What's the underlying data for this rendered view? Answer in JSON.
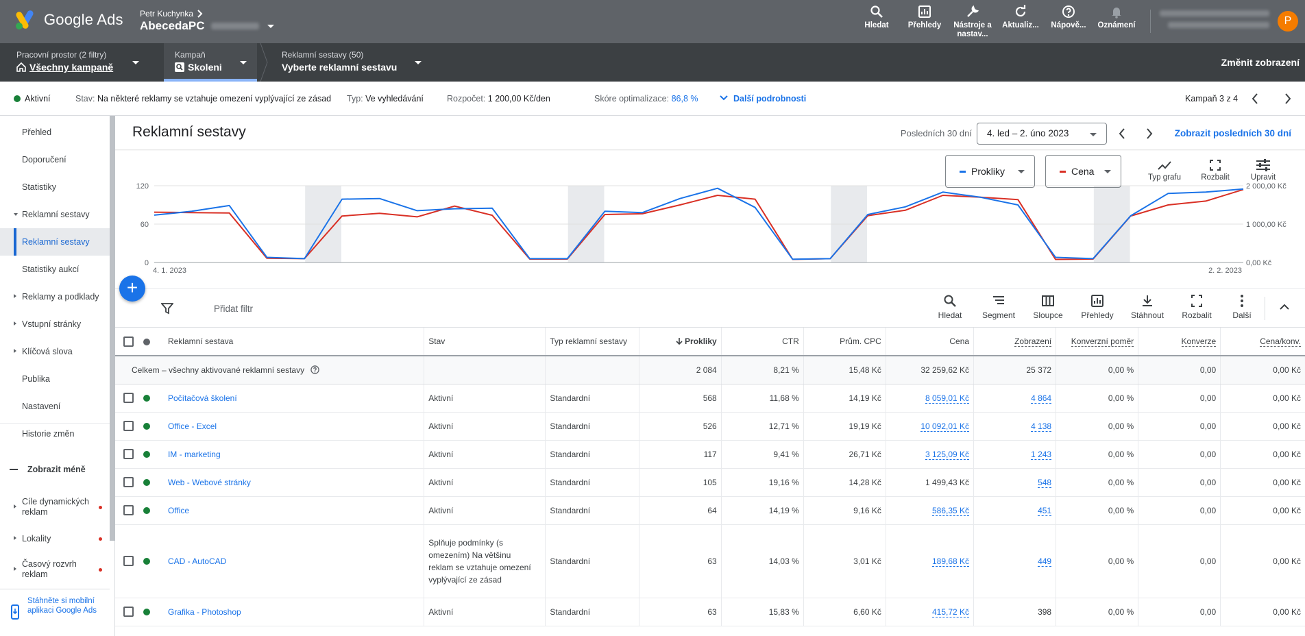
{
  "app": {
    "title": "Google Ads",
    "accent": "#1a73e8"
  },
  "account": {
    "name": "Petr Kuchynka",
    "sub": "AbecedaPC",
    "avatar_letter": "P"
  },
  "toolbar": {
    "items": [
      {
        "id": "search",
        "label": "Hledat",
        "icon": "search-icon"
      },
      {
        "id": "reports",
        "label": "Přehledy",
        "icon": "reports-icon"
      },
      {
        "id": "tools",
        "label": "Nástroje a nastav...",
        "icon": "wrench-icon"
      },
      {
        "id": "refresh",
        "label": "Aktualiz...",
        "icon": "refresh-icon"
      },
      {
        "id": "help",
        "label": "Nápově...",
        "icon": "help-icon"
      },
      {
        "id": "notif",
        "label": "Oznámení",
        "icon": "bell-icon"
      }
    ]
  },
  "nav": {
    "workspace_label": "Pracovní prostor (2 filtry)",
    "workspace_value": "Všechny kampaně",
    "campaign_label": "Kampaň",
    "campaign_value": "Skoleni",
    "adgroups_label": "Reklamní sestavy (50)",
    "adgroups_value": "Vyberte reklamní sestavu",
    "change_view": "Změnit zobrazení"
  },
  "status": {
    "active": "Aktivní",
    "state_label": "Stav:",
    "state_value": "Na některé reklamy se vztahuje omezení vyplývající ze zásad",
    "type_label": "Typ:",
    "type_value": "Ve vyhledávání",
    "budget_label": "Rozpočet:",
    "budget_value": "1 200,00 Kč/den",
    "score_label": "Skóre optimalizace:",
    "score_value": "86,8 %",
    "more_details": "Další podrobnosti",
    "campaign_pos": "Kampaň 3 z 4"
  },
  "sidebar": {
    "items": [
      {
        "label": "Přehled",
        "arrow": ""
      },
      {
        "label": "Doporučení",
        "arrow": ""
      },
      {
        "label": "Statistiky",
        "arrow": ""
      },
      {
        "label": "Reklamní sestavy",
        "arrow": "d"
      },
      {
        "label": "Reklamní sestavy",
        "arrow": "",
        "active": true
      },
      {
        "label": "Statistiky aukcí",
        "arrow": ""
      },
      {
        "label": "Reklamy a podklady",
        "arrow": "r"
      },
      {
        "label": "Vstupní stránky",
        "arrow": "r"
      },
      {
        "label": "Klíčová slova",
        "arrow": "r"
      },
      {
        "label": "Publika",
        "arrow": ""
      },
      {
        "label": "Nastavení",
        "arrow": ""
      },
      {
        "label": "Historie změn",
        "arrow": ""
      }
    ],
    "show_less": "Zobrazit méně",
    "extra": [
      {
        "label": "Cíle dynamických reklam"
      },
      {
        "label": "Lokality"
      },
      {
        "label": "Časový rozvrh reklam"
      }
    ],
    "mobile_app": "Stáhněte si mobilní aplikaci Google Ads"
  },
  "page": {
    "title": "Reklamní sestavy",
    "date_label": "Posledních 30 dní",
    "date_range": "4. led – 2. úno 2023",
    "date_link": "Zobrazit posledních 30 dní"
  },
  "chart": {
    "metric1": "Prokliky",
    "metric1_color": "#1a73e8",
    "metric2": "Cena",
    "metric2_color": "#d93025",
    "tools": [
      {
        "label": "Typ grafu",
        "icon": "line-chart-icon"
      },
      {
        "label": "Rozbalit",
        "icon": "expand-icon"
      },
      {
        "label": "Upravit",
        "icon": "tune-icon"
      }
    ],
    "x_start": "4. 1. 2023",
    "x_end": "2. 2. 2023"
  },
  "chart_data": {
    "type": "line",
    "x": [
      "4. 1. 2023",
      "5. 1.",
      "6. 1.",
      "7. 1.",
      "8. 1.",
      "9. 1.",
      "10. 1.",
      "11. 1.",
      "12. 1.",
      "13. 1.",
      "14. 1.",
      "15. 1.",
      "16. 1.",
      "17. 1.",
      "18. 1.",
      "19. 1.",
      "20. 1.",
      "21. 1.",
      "22. 1.",
      "23. 1.",
      "24. 1.",
      "25. 1.",
      "26. 1.",
      "27. 1.",
      "28. 1.",
      "29. 1.",
      "30. 1.",
      "31. 1.",
      "1. 2.",
      "2. 2. 2023"
    ],
    "series": [
      {
        "name": "Prokliky",
        "axis": "left",
        "values": [
          74,
          80,
          89,
          8,
          6,
          99,
          100,
          81,
          84,
          85,
          6,
          6,
          80,
          78,
          100,
          116,
          86,
          5,
          6,
          75,
          87,
          110,
          102,
          90,
          8,
          6,
          73,
          108,
          110,
          115
        ]
      },
      {
        "name": "Cena",
        "axis": "right",
        "values": [
          1310,
          1300,
          1290,
          110,
          100,
          1210,
          1280,
          1190,
          1470,
          1230,
          90,
          90,
          1250,
          1270,
          1500,
          1750,
          1650,
          80,
          100,
          1220,
          1360,
          1750,
          1700,
          1640,
          80,
          90,
          1210,
          1500,
          1600,
          1900
        ]
      }
    ],
    "y_left": {
      "ticks": [
        0,
        60,
        120
      ],
      "ylim": [
        0,
        120
      ]
    },
    "y_right": {
      "ticks": [
        "0,00 Kč",
        "1 000,00 Kč",
        "2 000,00 Kč"
      ],
      "ylim": [
        0,
        2000
      ]
    },
    "weekends": [
      [
        4,
        5
      ],
      [
        11,
        12
      ],
      [
        18,
        19
      ],
      [
        25,
        26
      ]
    ]
  },
  "filter": {
    "add_filter": "Přidat filtr"
  },
  "table_tools": [
    {
      "label": "Hledat",
      "icon": "search-icon"
    },
    {
      "label": "Segment",
      "icon": "segment-icon"
    },
    {
      "label": "Sloupce",
      "icon": "columns-icon"
    },
    {
      "label": "Přehledy",
      "icon": "reports-icon"
    },
    {
      "label": "Stáhnout",
      "icon": "download-icon"
    },
    {
      "label": "Rozbalit",
      "icon": "expand-icon"
    },
    {
      "label": "Další",
      "icon": "more-icon"
    }
  ],
  "table": {
    "headers": [
      "Reklamní sestava",
      "Stav",
      "Typ reklamní sestavy",
      "Prokliky",
      "CTR",
      "Prům. CPC",
      "Cena",
      "Zobrazení",
      "Konverzní poměr",
      "Konverze",
      "Cena/konv."
    ],
    "total": {
      "label": "Celkem – všechny aktivované reklamní sestavy",
      "clicks": "2 084",
      "ctr": "8,21 %",
      "cpc": "15,48 Kč",
      "cost": "32 259,62 Kč",
      "impr": "25 372",
      "conv_rate": "0,00 %",
      "conv": "0,00",
      "cost_conv": "0,00 Kč"
    },
    "rows": [
      {
        "name": "Počítačová školení",
        "status": "Aktivní",
        "type": "Standardní",
        "clicks": "568",
        "ctr": "11,68 %",
        "cpc": "14,19 Kč",
        "cost": "8 059,01 Kč",
        "impr": "4 864",
        "conv_rate": "0,00 %",
        "conv": "0,00",
        "cost_conv": "0,00 Kč",
        "cost_link": true,
        "impr_link": true
      },
      {
        "name": "Office - Excel",
        "status": "Aktivní",
        "type": "Standardní",
        "clicks": "526",
        "ctr": "12,71 %",
        "cpc": "19,19 Kč",
        "cost": "10 092,01 Kč",
        "impr": "4 138",
        "conv_rate": "0,00 %",
        "conv": "0,00",
        "cost_conv": "0,00 Kč",
        "cost_link": true,
        "impr_link": true
      },
      {
        "name": "IM - marketing",
        "status": "Aktivní",
        "type": "Standardní",
        "clicks": "117",
        "ctr": "9,41 %",
        "cpc": "26,71 Kč",
        "cost": "3 125,09 Kč",
        "impr": "1 243",
        "conv_rate": "0,00 %",
        "conv": "0,00",
        "cost_conv": "0,00 Kč",
        "cost_link": true,
        "impr_link": true
      },
      {
        "name": "Web - Webové stránky",
        "status": "Aktivní",
        "type": "Standardní",
        "clicks": "105",
        "ctr": "19,16 %",
        "cpc": "14,28 Kč",
        "cost": "1 499,43 Kč",
        "impr": "548",
        "conv_rate": "0,00 %",
        "conv": "0,00",
        "cost_conv": "0,00 Kč",
        "cost_link": false,
        "impr_link": true
      },
      {
        "name": "Office",
        "status": "Aktivní",
        "type": "Standardní",
        "clicks": "64",
        "ctr": "14,19 %",
        "cpc": "9,16 Kč",
        "cost": "586,35 Kč",
        "impr": "451",
        "conv_rate": "0,00 %",
        "conv": "0,00",
        "cost_conv": "0,00 Kč",
        "cost_link": true,
        "impr_link": true
      },
      {
        "name": "CAD - AutoCAD",
        "status": "Splňuje podmínky (s omezením) Na většinu reklam se vztahuje omezení vyplývající ze zásad",
        "type": "Standardní",
        "clicks": "63",
        "ctr": "14,03 %",
        "cpc": "3,01 Kč",
        "cost": "189,68 Kč",
        "impr": "449",
        "conv_rate": "0,00 %",
        "conv": "0,00",
        "cost_conv": "0,00 Kč",
        "cost_link": true,
        "impr_link": true,
        "tall": true
      },
      {
        "name": "Grafika - Photoshop",
        "status": "Aktivní",
        "type": "Standardní",
        "clicks": "63",
        "ctr": "15,83 %",
        "cpc": "6,60 Kč",
        "cost": "415,72 Kč",
        "impr": "398",
        "conv_rate": "0,00 %",
        "conv": "0,00",
        "cost_conv": "0,00 Kč",
        "cost_link": true,
        "impr_link": false
      }
    ]
  }
}
